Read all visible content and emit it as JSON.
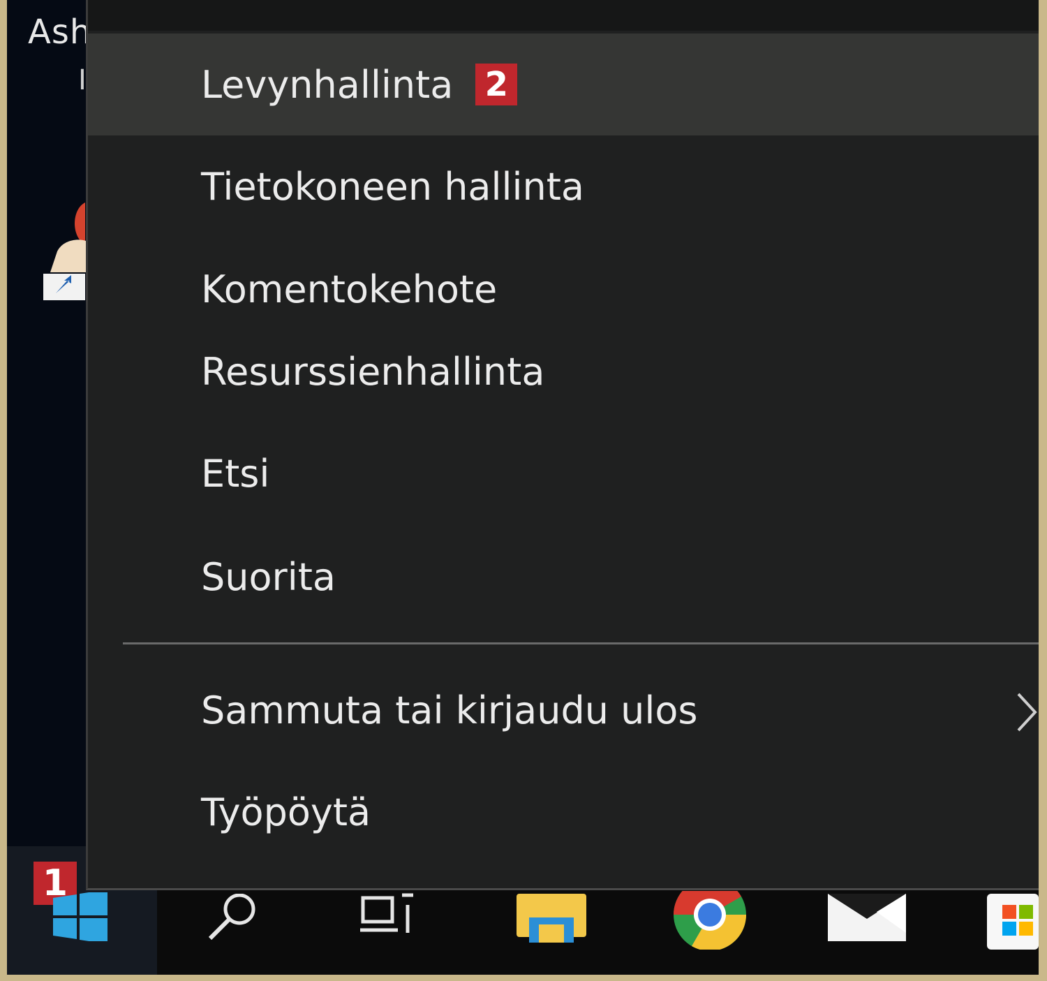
{
  "desktop": {
    "label_top": "Ash",
    "label_second": "I"
  },
  "start": {
    "badge": "1"
  },
  "context_menu": {
    "items": [
      {
        "label": "Levynhallinta",
        "badge": "2"
      },
      {
        "label": "Tietokoneen hallinta"
      },
      {
        "label": "Komentokehote"
      },
      {
        "label": "Resurssienhallinta"
      },
      {
        "label": "Etsi"
      },
      {
        "label": "Suorita"
      },
      {
        "label": "Sammuta tai kirjaudu ulos",
        "has_submenu": true
      },
      {
        "label": "Työpöytä"
      }
    ]
  },
  "taskbar": {
    "icons": [
      "windows-start-icon",
      "search-icon",
      "task-view-icon",
      "file-explorer-icon",
      "chrome-icon",
      "mail-icon",
      "store-icon"
    ]
  },
  "colors": {
    "badge": "#c0272d",
    "menu_bg": "#1f2020",
    "menu_hover": "#353634",
    "menu_text": "#ececec"
  }
}
